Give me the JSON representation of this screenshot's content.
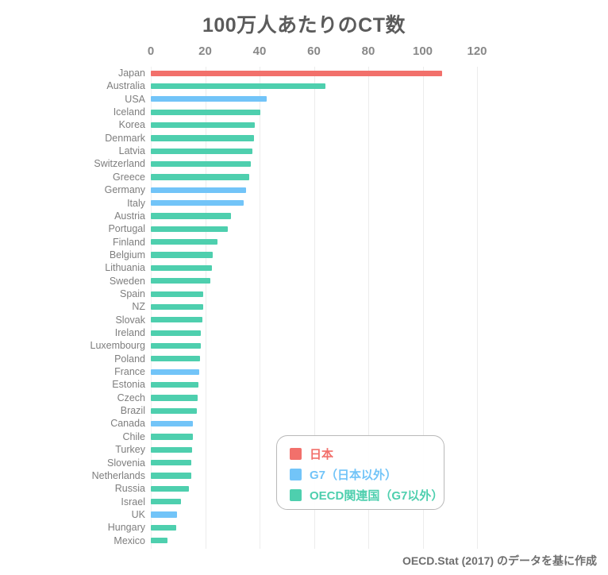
{
  "chart_data": {
    "type": "bar",
    "orientation": "horizontal",
    "title": "100万人あたりのCT数",
    "xlabel": "",
    "ylabel": "",
    "xlim": [
      0,
      120
    ],
    "xticks": [
      0,
      20,
      40,
      60,
      80,
      100,
      120
    ],
    "grid": true,
    "legend_position": "inside-bottom-right",
    "categories": [
      "Japan",
      "Australia",
      "USA",
      "Iceland",
      "Korea",
      "Denmark",
      "Latvia",
      "Switzerland",
      "Greece",
      "Germany",
      "Italy",
      "Austria",
      "Portugal",
      "Finland",
      "Belgium",
      "Lithuania",
      "Sweden",
      "Spain",
      "NZ",
      "Slovak",
      "Ireland",
      "Luxembourg",
      "Poland",
      "France",
      "Estonia",
      "Czech",
      "Brazil",
      "Canada",
      "Chile",
      "Turkey",
      "Slovenia",
      "Netherlands",
      "Russia",
      "Israel",
      "UK",
      "Hungary",
      "Mexico"
    ],
    "values": [
      107.2,
      64.3,
      42.6,
      40.2,
      38.2,
      38.0,
      37.3,
      36.8,
      36.3,
      35.1,
      34.2,
      29.4,
      28.2,
      24.6,
      22.8,
      22.4,
      22.0,
      19.4,
      19.2,
      18.9,
      18.5,
      18.4,
      18.2,
      17.7,
      17.5,
      17.3,
      16.9,
      15.6,
      15.4,
      15.2,
      15.0,
      14.8,
      14.0,
      11.0,
      9.6,
      9.3,
      6.0
    ],
    "groups": [
      "japan",
      "oecd",
      "g7",
      "oecd",
      "oecd",
      "oecd",
      "oecd",
      "oecd",
      "oecd",
      "g7",
      "g7",
      "oecd",
      "oecd",
      "oecd",
      "oecd",
      "oecd",
      "oecd",
      "oecd",
      "oecd",
      "oecd",
      "oecd",
      "oecd",
      "oecd",
      "g7",
      "oecd",
      "oecd",
      "oecd",
      "g7",
      "oecd",
      "oecd",
      "oecd",
      "oecd",
      "oecd",
      "oecd",
      "g7",
      "oecd",
      "oecd"
    ],
    "series": [
      {
        "name": "日本",
        "key": "japan",
        "color": "#f2706b"
      },
      {
        "name": "G7（日本以外）",
        "key": "g7",
        "color": "#72c4f8"
      },
      {
        "name": "OECD関連国（G7以外）",
        "key": "oecd",
        "color": "#4ecfae"
      }
    ],
    "annotations": {
      "source": "OECD.Stat (2017) のデータを基に作成"
    }
  },
  "legend": {
    "items": [
      {
        "label": "日本",
        "color": "#f2706b"
      },
      {
        "label": "G7（日本以外）",
        "color": "#72c4f8"
      },
      {
        "label": "OECD関連国（G7以外）",
        "color": "#4ecfae"
      }
    ]
  },
  "footer": {
    "source_text": "OECD.Stat (2017) のデータを基に作成"
  },
  "colors": {
    "japan": "#f2706b",
    "g7": "#72c4f8",
    "oecd": "#4ecfae",
    "grid": "#ececec",
    "title": "#5b5b5b",
    "tick": "#888888",
    "category": "#7e7e7e",
    "background": "#ffffff"
  }
}
